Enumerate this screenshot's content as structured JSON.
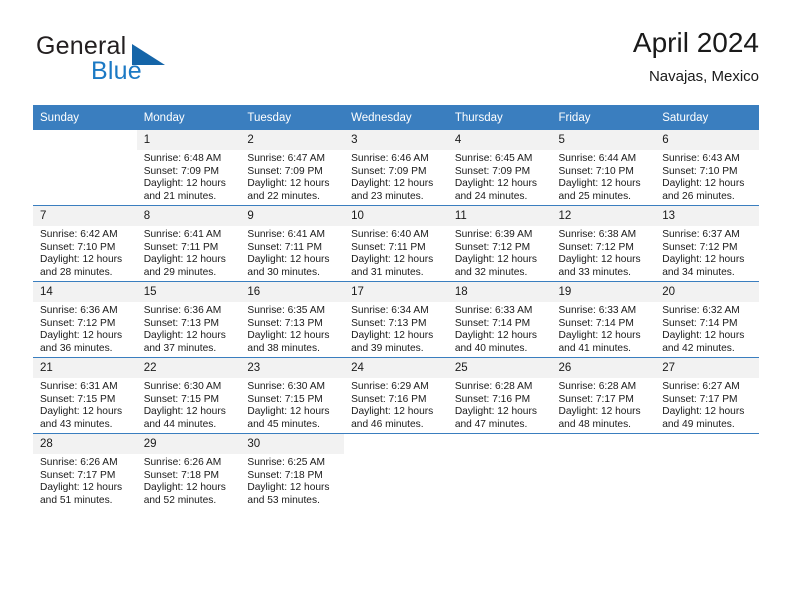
{
  "brand": {
    "name_part1": "General",
    "name_part2": "Blue",
    "triangle_icon": "triangle-icon"
  },
  "header": {
    "title": "April 2024",
    "location": "Navajas, Mexico"
  },
  "colors": {
    "header_blue": "#3a7ebf",
    "brand_blue": "#1b79c4",
    "triangle_blue": "#1565a8",
    "daynum_bg": "#f2f2f2",
    "text": "#1a1a1a"
  },
  "weekday_headers": [
    "Sunday",
    "Monday",
    "Tuesday",
    "Wednesday",
    "Thursday",
    "Friday",
    "Saturday"
  ],
  "labels": {
    "sunrise": "Sunrise:",
    "sunset": "Sunset:",
    "daylight": "Daylight:"
  },
  "weeks": [
    [
      {
        "day": "",
        "sunrise": "",
        "sunset": "",
        "daylight1": "",
        "daylight2": "",
        "empty": true
      },
      {
        "day": "1",
        "sunrise": "Sunrise: 6:48 AM",
        "sunset": "Sunset: 7:09 PM",
        "daylight1": "Daylight: 12 hours",
        "daylight2": "and 21 minutes."
      },
      {
        "day": "2",
        "sunrise": "Sunrise: 6:47 AM",
        "sunset": "Sunset: 7:09 PM",
        "daylight1": "Daylight: 12 hours",
        "daylight2": "and 22 minutes."
      },
      {
        "day": "3",
        "sunrise": "Sunrise: 6:46 AM",
        "sunset": "Sunset: 7:09 PM",
        "daylight1": "Daylight: 12 hours",
        "daylight2": "and 23 minutes."
      },
      {
        "day": "4",
        "sunrise": "Sunrise: 6:45 AM",
        "sunset": "Sunset: 7:09 PM",
        "daylight1": "Daylight: 12 hours",
        "daylight2": "and 24 minutes."
      },
      {
        "day": "5",
        "sunrise": "Sunrise: 6:44 AM",
        "sunset": "Sunset: 7:10 PM",
        "daylight1": "Daylight: 12 hours",
        "daylight2": "and 25 minutes."
      },
      {
        "day": "6",
        "sunrise": "Sunrise: 6:43 AM",
        "sunset": "Sunset: 7:10 PM",
        "daylight1": "Daylight: 12 hours",
        "daylight2": "and 26 minutes."
      }
    ],
    [
      {
        "day": "7",
        "sunrise": "Sunrise: 6:42 AM",
        "sunset": "Sunset: 7:10 PM",
        "daylight1": "Daylight: 12 hours",
        "daylight2": "and 28 minutes."
      },
      {
        "day": "8",
        "sunrise": "Sunrise: 6:41 AM",
        "sunset": "Sunset: 7:11 PM",
        "daylight1": "Daylight: 12 hours",
        "daylight2": "and 29 minutes."
      },
      {
        "day": "9",
        "sunrise": "Sunrise: 6:41 AM",
        "sunset": "Sunset: 7:11 PM",
        "daylight1": "Daylight: 12 hours",
        "daylight2": "and 30 minutes."
      },
      {
        "day": "10",
        "sunrise": "Sunrise: 6:40 AM",
        "sunset": "Sunset: 7:11 PM",
        "daylight1": "Daylight: 12 hours",
        "daylight2": "and 31 minutes."
      },
      {
        "day": "11",
        "sunrise": "Sunrise: 6:39 AM",
        "sunset": "Sunset: 7:12 PM",
        "daylight1": "Daylight: 12 hours",
        "daylight2": "and 32 minutes."
      },
      {
        "day": "12",
        "sunrise": "Sunrise: 6:38 AM",
        "sunset": "Sunset: 7:12 PM",
        "daylight1": "Daylight: 12 hours",
        "daylight2": "and 33 minutes."
      },
      {
        "day": "13",
        "sunrise": "Sunrise: 6:37 AM",
        "sunset": "Sunset: 7:12 PM",
        "daylight1": "Daylight: 12 hours",
        "daylight2": "and 34 minutes."
      }
    ],
    [
      {
        "day": "14",
        "sunrise": "Sunrise: 6:36 AM",
        "sunset": "Sunset: 7:12 PM",
        "daylight1": "Daylight: 12 hours",
        "daylight2": "and 36 minutes."
      },
      {
        "day": "15",
        "sunrise": "Sunrise: 6:36 AM",
        "sunset": "Sunset: 7:13 PM",
        "daylight1": "Daylight: 12 hours",
        "daylight2": "and 37 minutes."
      },
      {
        "day": "16",
        "sunrise": "Sunrise: 6:35 AM",
        "sunset": "Sunset: 7:13 PM",
        "daylight1": "Daylight: 12 hours",
        "daylight2": "and 38 minutes."
      },
      {
        "day": "17",
        "sunrise": "Sunrise: 6:34 AM",
        "sunset": "Sunset: 7:13 PM",
        "daylight1": "Daylight: 12 hours",
        "daylight2": "and 39 minutes."
      },
      {
        "day": "18",
        "sunrise": "Sunrise: 6:33 AM",
        "sunset": "Sunset: 7:14 PM",
        "daylight1": "Daylight: 12 hours",
        "daylight2": "and 40 minutes."
      },
      {
        "day": "19",
        "sunrise": "Sunrise: 6:33 AM",
        "sunset": "Sunset: 7:14 PM",
        "daylight1": "Daylight: 12 hours",
        "daylight2": "and 41 minutes."
      },
      {
        "day": "20",
        "sunrise": "Sunrise: 6:32 AM",
        "sunset": "Sunset: 7:14 PM",
        "daylight1": "Daylight: 12 hours",
        "daylight2": "and 42 minutes."
      }
    ],
    [
      {
        "day": "21",
        "sunrise": "Sunrise: 6:31 AM",
        "sunset": "Sunset: 7:15 PM",
        "daylight1": "Daylight: 12 hours",
        "daylight2": "and 43 minutes."
      },
      {
        "day": "22",
        "sunrise": "Sunrise: 6:30 AM",
        "sunset": "Sunset: 7:15 PM",
        "daylight1": "Daylight: 12 hours",
        "daylight2": "and 44 minutes."
      },
      {
        "day": "23",
        "sunrise": "Sunrise: 6:30 AM",
        "sunset": "Sunset: 7:15 PM",
        "daylight1": "Daylight: 12 hours",
        "daylight2": "and 45 minutes."
      },
      {
        "day": "24",
        "sunrise": "Sunrise: 6:29 AM",
        "sunset": "Sunset: 7:16 PM",
        "daylight1": "Daylight: 12 hours",
        "daylight2": "and 46 minutes."
      },
      {
        "day": "25",
        "sunrise": "Sunrise: 6:28 AM",
        "sunset": "Sunset: 7:16 PM",
        "daylight1": "Daylight: 12 hours",
        "daylight2": "and 47 minutes."
      },
      {
        "day": "26",
        "sunrise": "Sunrise: 6:28 AM",
        "sunset": "Sunset: 7:17 PM",
        "daylight1": "Daylight: 12 hours",
        "daylight2": "and 48 minutes."
      },
      {
        "day": "27",
        "sunrise": "Sunrise: 6:27 AM",
        "sunset": "Sunset: 7:17 PM",
        "daylight1": "Daylight: 12 hours",
        "daylight2": "and 49 minutes."
      }
    ],
    [
      {
        "day": "28",
        "sunrise": "Sunrise: 6:26 AM",
        "sunset": "Sunset: 7:17 PM",
        "daylight1": "Daylight: 12 hours",
        "daylight2": "and 51 minutes."
      },
      {
        "day": "29",
        "sunrise": "Sunrise: 6:26 AM",
        "sunset": "Sunset: 7:18 PM",
        "daylight1": "Daylight: 12 hours",
        "daylight2": "and 52 minutes."
      },
      {
        "day": "30",
        "sunrise": "Sunrise: 6:25 AM",
        "sunset": "Sunset: 7:18 PM",
        "daylight1": "Daylight: 12 hours",
        "daylight2": "and 53 minutes."
      },
      {
        "day": "",
        "sunrise": "",
        "sunset": "",
        "daylight1": "",
        "daylight2": "",
        "empty": true
      },
      {
        "day": "",
        "sunrise": "",
        "sunset": "",
        "daylight1": "",
        "daylight2": "",
        "empty": true
      },
      {
        "day": "",
        "sunrise": "",
        "sunset": "",
        "daylight1": "",
        "daylight2": "",
        "empty": true
      },
      {
        "day": "",
        "sunrise": "",
        "sunset": "",
        "daylight1": "",
        "daylight2": "",
        "empty": true
      }
    ]
  ]
}
